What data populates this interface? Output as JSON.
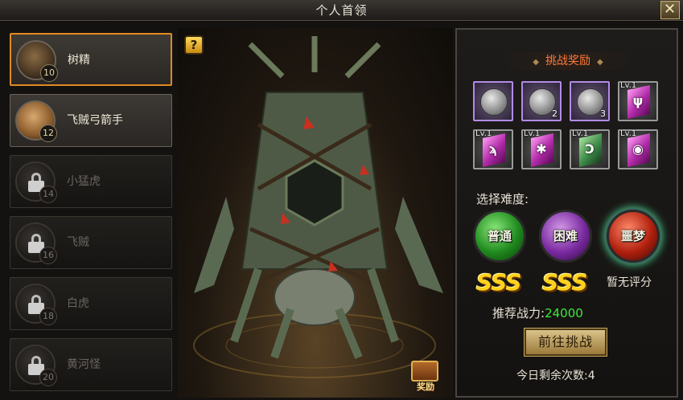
{
  "window": {
    "title": "个人首领",
    "close_label": "✕"
  },
  "bosses": [
    {
      "name": "树精",
      "level": "10",
      "state": "active"
    },
    {
      "name": "飞贼弓箭手",
      "level": "12",
      "state": "unlocked"
    },
    {
      "name": "小猛虎",
      "level": "14",
      "state": "locked"
    },
    {
      "name": "飞贼",
      "level": "16",
      "state": "locked"
    },
    {
      "name": "白虎",
      "level": "18",
      "state": "locked"
    },
    {
      "name": "黄河怪",
      "level": "20",
      "state": "locked"
    }
  ],
  "stage": {
    "help_label": "?",
    "reward_label": "奖励"
  },
  "panel": {
    "header": "挑战奖励",
    "rewards": [
      {
        "kind": "coin",
        "color": "purple",
        "count": ""
      },
      {
        "kind": "coin",
        "color": "purple",
        "count": "2"
      },
      {
        "kind": "coin",
        "color": "purple",
        "count": "3"
      },
      {
        "kind": "crystal",
        "color": "gray",
        "level": "Lv.1",
        "rune": "ψ"
      },
      {
        "kind": "crystal",
        "color": "gray",
        "level": "Lv.1",
        "rune": "ϡ"
      },
      {
        "kind": "crystal",
        "color": "gray",
        "level": "Lv.1",
        "rune": "✱"
      },
      {
        "kind": "crystal-green",
        "color": "gray",
        "level": "Lv.1",
        "rune": "Ͻ"
      },
      {
        "kind": "crystal",
        "color": "gray",
        "level": "Lv.1",
        "rune": "◉"
      }
    ],
    "select_label": "选择难度:",
    "difficulties": [
      "普通",
      "困难",
      "噩梦"
    ],
    "grades": [
      "SSS",
      "SSS",
      "暂无评分"
    ],
    "power_label": "推荐战力:",
    "power_value": "24000",
    "go_button": "前往挑战",
    "remaining": "今日剩余次数:4"
  }
}
